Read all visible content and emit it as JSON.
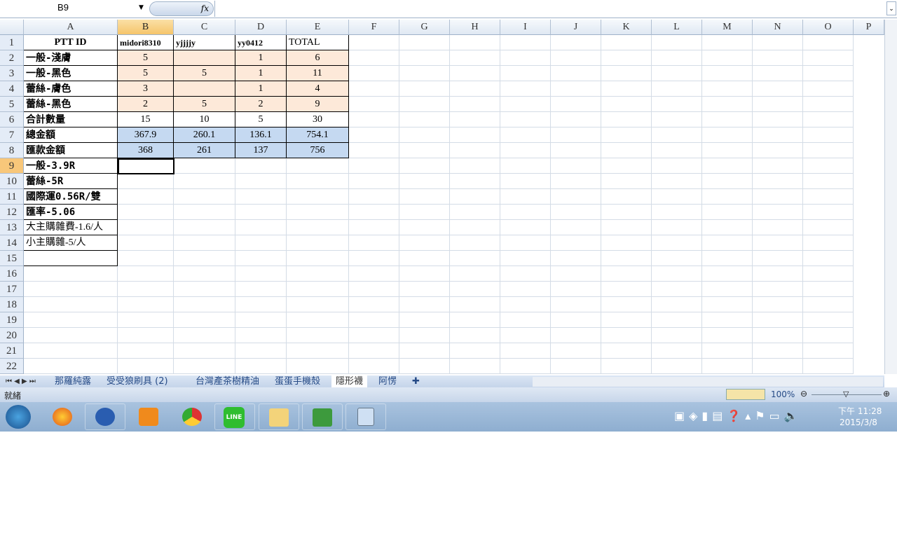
{
  "formula_bar": {
    "name_box": "B9",
    "fx_label": "fx",
    "formula": ""
  },
  "columns": [
    "A",
    "B",
    "C",
    "D",
    "E",
    "F",
    "G",
    "H",
    "I",
    "J",
    "K",
    "L",
    "M",
    "N",
    "O",
    "P"
  ],
  "selected": {
    "col": "B",
    "row": 9
  },
  "rows": [
    [
      "PTT ID",
      "midori8310",
      "yjjjjy",
      "yy0412",
      "TOTAL"
    ],
    [
      "一般-淺膚",
      "5",
      "",
      "1",
      "6"
    ],
    [
      "一般-黑色",
      "5",
      "5",
      "1",
      "11"
    ],
    [
      "蕾絲-膚色",
      "3",
      "",
      "1",
      "4"
    ],
    [
      "蕾絲-黑色",
      "2",
      "5",
      "2",
      "9"
    ],
    [
      "合計數量",
      "15",
      "10",
      "5",
      "30"
    ],
    [
      "總金額",
      "367.9",
      "260.1",
      "136.1",
      "754.1"
    ],
    [
      "匯款金額",
      "368",
      "261",
      "137",
      "756"
    ],
    [
      "一般-3.9R",
      "",
      "",
      "",
      ""
    ],
    [
      "蕾絲-5R",
      "",
      "",
      "",
      ""
    ],
    [
      "國際運0.56R/雙",
      "",
      "",
      "",
      ""
    ],
    [
      "匯率-5.06",
      "",
      "",
      "",
      ""
    ],
    [
      "大主購雜費-1.6/人",
      "",
      "",
      "",
      ""
    ],
    [
      "小主購雜-5/人",
      "",
      "",
      "",
      ""
    ],
    [
      "",
      "",
      "",
      "",
      ""
    ]
  ],
  "row_count": 22,
  "colors": {
    "peach": "#fde9d9",
    "blue": "#c5d9f1",
    "selected_header": "#f8c77a"
  },
  "sheet_tabs": [
    "那羅純露",
    "受受狼刷具 (2)",
    "台灣產茶樹精油",
    "蛋蛋手機殼",
    "隱形襪",
    "阿愣"
  ],
  "active_tab": "隱形襪",
  "status": {
    "ready": "就緒",
    "zoom": "100%"
  },
  "taskbar": {
    "apps": [
      "start",
      "firefox",
      "app",
      "media-player",
      "chrome",
      "line",
      "explorer",
      "excel",
      "calculator"
    ],
    "time": "下午 11:28",
    "date": "2015/3/8",
    "line_label": "LINE"
  }
}
